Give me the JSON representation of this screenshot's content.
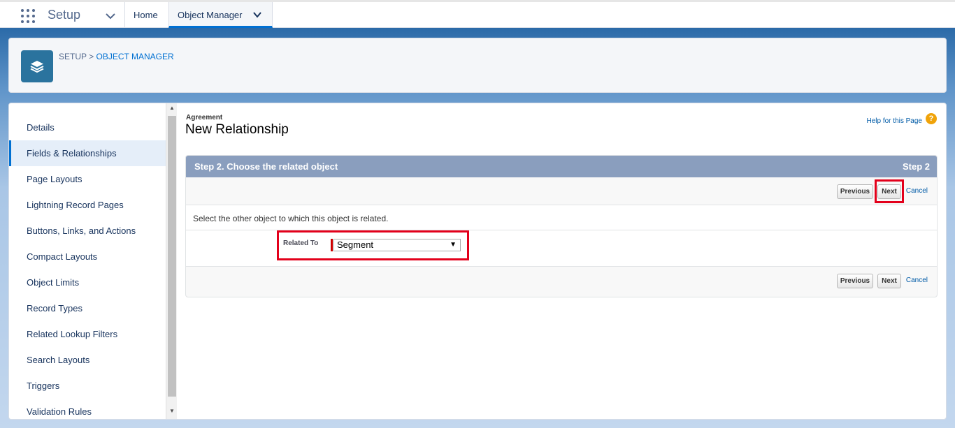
{
  "topnav": {
    "app_name": "Setup",
    "tabs": [
      {
        "label": "Home"
      },
      {
        "label": "Object Manager"
      }
    ]
  },
  "header": {
    "breadcrumb_root": "SETUP",
    "breadcrumb_sep": ">",
    "breadcrumb_current": "OBJECT MANAGER"
  },
  "sidebar": {
    "items": [
      {
        "label": "Details"
      },
      {
        "label": "Fields & Relationships"
      },
      {
        "label": "Page Layouts"
      },
      {
        "label": "Lightning Record Pages"
      },
      {
        "label": "Buttons, Links, and Actions"
      },
      {
        "label": "Compact Layouts"
      },
      {
        "label": "Object Limits"
      },
      {
        "label": "Record Types"
      },
      {
        "label": "Related Lookup Filters"
      },
      {
        "label": "Search Layouts"
      },
      {
        "label": "Triggers"
      },
      {
        "label": "Validation Rules"
      }
    ],
    "active_index": 1
  },
  "content": {
    "object_label": "Agreement",
    "page_title": "New Relationship",
    "help_link": "Help for this Page",
    "help_icon_glyph": "?",
    "step_title": "Step 2. Choose the related object",
    "step_number": "Step 2",
    "previous_label": "Previous",
    "next_label": "Next",
    "cancel_label": "Cancel",
    "instruction": "Select the other object to which this object is related.",
    "field_label": "Related To",
    "field_value": "Segment",
    "caret_glyph": "▼"
  },
  "colors": {
    "brand_blue": "#0070d2",
    "step_header": "#8a9ebe",
    "highlight_red": "#e3001b",
    "help_orange": "#f0a30a"
  },
  "icons": {
    "launcher": "app-launcher-icon",
    "app_chevron": "chevron-down-icon",
    "header": "layers-icon",
    "help": "help-icon"
  }
}
